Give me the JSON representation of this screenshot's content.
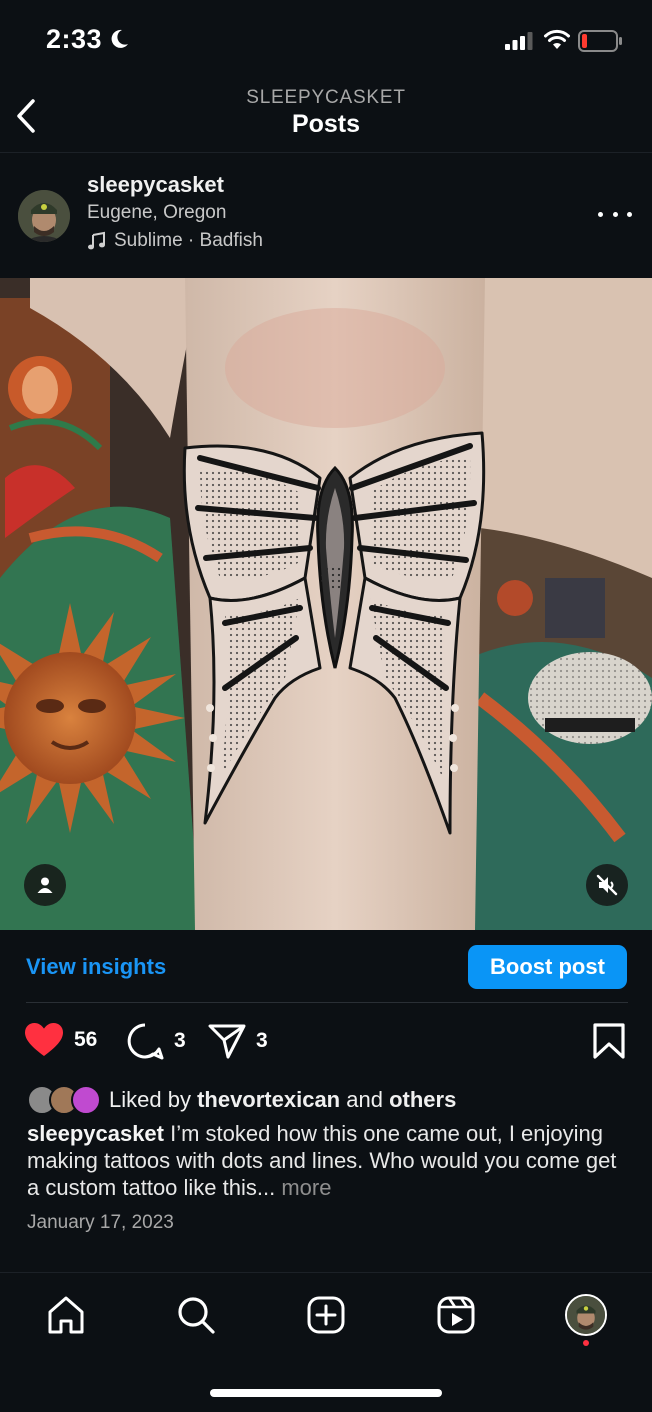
{
  "status_bar": {
    "time": "2:33",
    "icons": [
      "moon-icon",
      "signal-icon",
      "wifi-icon",
      "battery-icon"
    ]
  },
  "header": {
    "account": "SLEEPYCASKET",
    "title": "Posts",
    "back_icon": "chevron-left-icon"
  },
  "post": {
    "username": "sleepycasket",
    "location": "Eugene, Oregon",
    "music": "Sublime · Badfish",
    "more_icon": "more-horizontal-icon",
    "image_icons": [
      "person-tag-icon",
      "speaker-muted-icon"
    ]
  },
  "insights": {
    "view_label": "View insights",
    "boost_label": "Boost post"
  },
  "actions": {
    "likes_count": "56",
    "comments_count": "3",
    "shares_count": "3",
    "icons": [
      "heart-filled-icon",
      "comment-icon",
      "send-icon",
      "bookmark-icon"
    ]
  },
  "likes": {
    "prefix": "Liked by ",
    "user": "thevortexican",
    "middle": " and ",
    "others": "others"
  },
  "caption": {
    "username": "sleepycasket",
    "text": " I’m stoked how this one came out, I enjoying making tattoos with dots and lines.  Who would you come get a custom tattoo like this...",
    "more": " more"
  },
  "date": "January 17, 2023",
  "bottom_nav": [
    "home-icon",
    "search-icon",
    "create-icon",
    "reels-icon",
    "profile-avatar"
  ],
  "colors": {
    "background": "#0c1014",
    "accent": "#0a95f6",
    "like_red": "#ff3040"
  }
}
